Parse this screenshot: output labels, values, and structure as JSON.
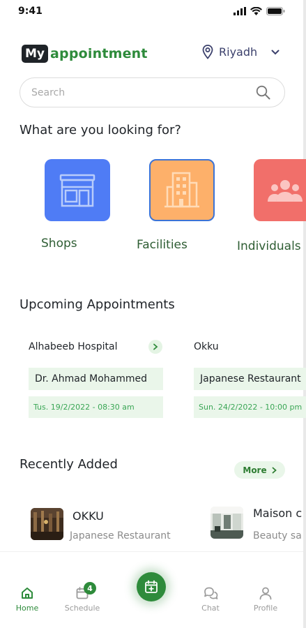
{
  "status_bar": {
    "time": "9:41"
  },
  "header": {
    "logo_badge": "My",
    "logo_text": "appointment",
    "location": "Riyadh"
  },
  "search": {
    "placeholder": "Search"
  },
  "categories": {
    "title": "What are you looking for?",
    "items": [
      {
        "label": "Shops",
        "color": "#4f7cf5",
        "icon": "storefront-icon"
      },
      {
        "label": "Facilities",
        "color": "#fdb06a",
        "icon": "building-icon"
      },
      {
        "label": "Individuals",
        "color": "#f16f6a",
        "icon": "people-icon"
      }
    ]
  },
  "upcoming": {
    "title": "Upcoming Appointments",
    "items": [
      {
        "place": "Alhabeeb Hospital",
        "name": "Dr. Ahmad Mohammed",
        "datetime": "Tus. 19/2/2022 - 08:30 am"
      },
      {
        "place": "Okku",
        "name": "Japanese Restaurant",
        "datetime": "Sun. 24/2/2022 - 10:00 pm"
      }
    ]
  },
  "recent": {
    "title": "Recently Added",
    "more_label": "More",
    "items": [
      {
        "name": "OKKU",
        "subtitle": "Japanese Restaurant"
      },
      {
        "name": "Maison c",
        "subtitle": "Beauty sa"
      }
    ]
  },
  "tab_bar": {
    "items": [
      {
        "label": "Home",
        "icon": "home-icon",
        "active": true
      },
      {
        "label": "Schedule",
        "icon": "calendar-icon",
        "badge": "4"
      },
      {
        "label": "Chat",
        "icon": "chat-icon"
      },
      {
        "label": "Profile",
        "icon": "user-icon"
      }
    ]
  },
  "colors": {
    "brand_green": "#2e8b3b",
    "light_green": "#eaf6ea",
    "date_green": "#3aa655"
  }
}
